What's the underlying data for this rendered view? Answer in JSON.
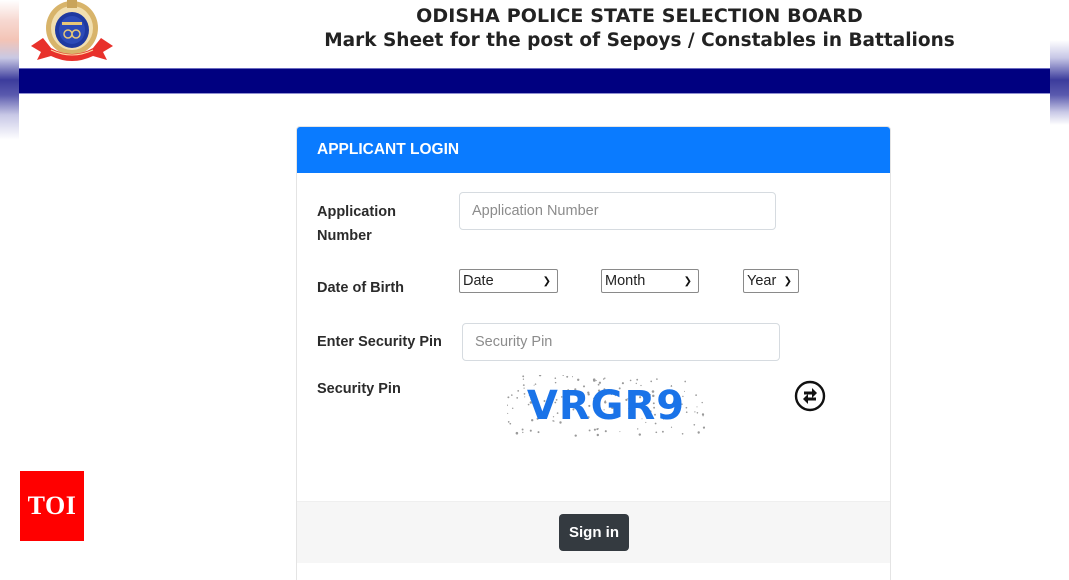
{
  "header": {
    "title": "ODISHA POLICE STATE SELECTION BOARD",
    "subtitle": "Mark Sheet for the post of Sepoys / Constables in Battalions",
    "logo_icon": "odisha-police-emblem"
  },
  "colors": {
    "navbar": "#000080",
    "card_header": "#0a7bff",
    "signin_button": "#343a40",
    "captcha_text": "#1a73e8",
    "watermark": "#ff0000"
  },
  "login": {
    "heading": "APPLICANT LOGIN",
    "application_number": {
      "label": "Application Number",
      "placeholder": "Application Number",
      "value": ""
    },
    "date_of_birth": {
      "label": "Date of Birth",
      "date_select": "Date",
      "month_select": "Month",
      "year_select": "Year"
    },
    "security_pin_input": {
      "label": "Enter Security Pin",
      "placeholder": "Security Pin",
      "value": ""
    },
    "security_pin_captcha": {
      "label": "Security Pin",
      "captcha_text": "VRGR9",
      "refresh_icon": "refresh-icon"
    },
    "signin_label": "Sign in"
  },
  "watermark": {
    "text": "TOI"
  }
}
